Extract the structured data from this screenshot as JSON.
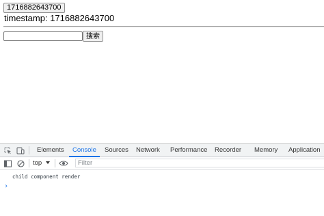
{
  "page": {
    "timestamp_button_label": "1716882643700",
    "timestamp_prefix": "timestamp: ",
    "timestamp_value": "1716882643700",
    "search": {
      "value": "",
      "placeholder": "",
      "button_label": "搜索"
    }
  },
  "devtools": {
    "tabs": [
      {
        "label": "Elements",
        "active": false
      },
      {
        "label": "Console",
        "active": true
      },
      {
        "label": "Sources",
        "active": false
      },
      {
        "label": "Network",
        "active": false
      },
      {
        "label": "Performance",
        "active": false
      },
      {
        "label": "Recorder",
        "active": false
      },
      {
        "label": "Memory",
        "active": false
      },
      {
        "label": "Application",
        "active": false
      }
    ],
    "icons": {
      "inspect": "inspect-element-icon",
      "device": "device-toolbar-icon",
      "sidebar": "sidebar-toggle-icon",
      "clear": "clear-console-icon",
      "eye": "live-expression-icon"
    },
    "context_selector": "top",
    "filter_placeholder": "Filter",
    "log_messages": [
      "child component render"
    ],
    "prompt_symbol": "›",
    "accent_color": "#1a73e8"
  }
}
